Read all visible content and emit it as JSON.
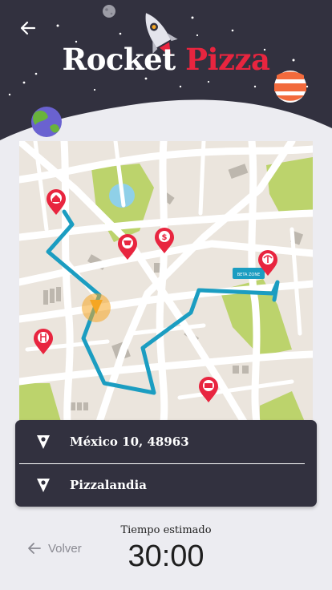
{
  "app": {
    "title_part1": "Rocket",
    "title_part2": "Pizza"
  },
  "colors": {
    "header_bg": "#32313f",
    "brand_red": "#e8253f",
    "route": "#1b9dc1",
    "page_bg": "#ececf1"
  },
  "map": {
    "destination_tag": "BETA ZONE"
  },
  "route_card": {
    "items": [
      {
        "icon": "pizza-slice-pin-icon",
        "label": "México 10, 48963"
      },
      {
        "icon": "pizza-slice-pin-icon",
        "label": "Pizzalandia"
      }
    ]
  },
  "footer": {
    "back_label": "Volver",
    "eta_label": "Tiempo estimado",
    "eta_value": "30:00"
  }
}
